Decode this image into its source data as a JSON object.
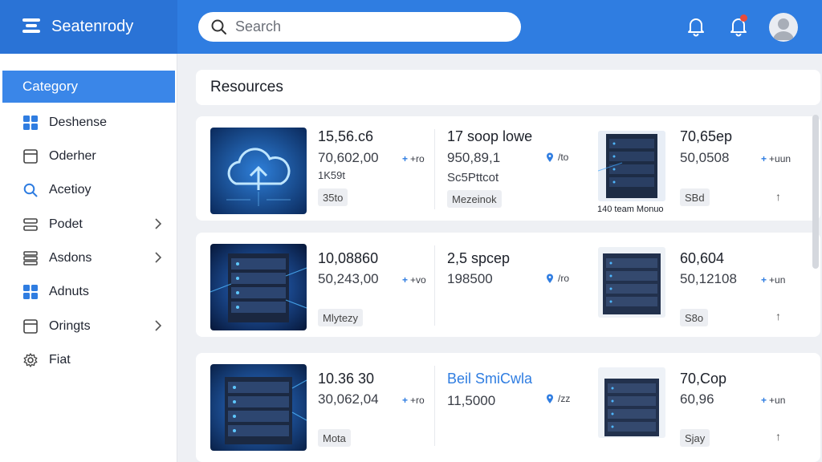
{
  "app": {
    "name": "Seatenrody"
  },
  "search": {
    "placeholder": "Search"
  },
  "sidebar": {
    "category": "Category",
    "items": [
      {
        "label": "Deshense",
        "icon": "grid-icon"
      },
      {
        "label": "Oderher",
        "icon": "window-icon"
      },
      {
        "label": "Acetioy",
        "icon": "search-icon"
      },
      {
        "label": "Podet",
        "icon": "list-icon"
      },
      {
        "label": "Asdons",
        "icon": "list-icon"
      },
      {
        "label": "Adnuts",
        "icon": "grid-icon"
      },
      {
        "label": "Oringts",
        "icon": "window-icon"
      },
      {
        "label": "Fiat",
        "icon": "gear-icon"
      }
    ]
  },
  "main": {
    "title": "Resources",
    "rows": [
      {
        "col1": {
          "title": "15,56.c6",
          "value": "70,602,00",
          "sub": "1K59t",
          "meta": "+ro",
          "chip": "35to"
        },
        "col2": {
          "title": "17 soop lowe",
          "value": "950,89,1",
          "sub": "Sc5Pttcot",
          "meta": "/to",
          "chip": "Mezeinok"
        },
        "col3": {
          "title": "70,65ep",
          "value": "50,0508",
          "meta": "+uun",
          "chip": "SBd",
          "caption": "140 team Monuo"
        }
      },
      {
        "col1": {
          "title": "10,08860",
          "value": "50,243,00",
          "meta": "+vo",
          "chip": "Mlytezy"
        },
        "col2": {
          "title": "2,5 spcep",
          "value": "198500",
          "meta": "/ro"
        },
        "col3": {
          "title": "60,604",
          "value": "50,12108",
          "meta": "+un",
          "chip": "S8o"
        }
      },
      {
        "col1": {
          "title": "10.36 30",
          "value": "30,062,04",
          "meta": "+ro",
          "chip": "Mota"
        },
        "col2": {
          "title": "Beil SmiCwla",
          "value": "11,5000",
          "meta": "/zz"
        },
        "col3": {
          "title": "70,Cop",
          "value": "60,96",
          "meta": "+un",
          "chip": "Sjay"
        }
      }
    ]
  },
  "colors": {
    "brand": "#2f7de1",
    "accent": "#3a86e8",
    "notification": "#e74c3c"
  }
}
